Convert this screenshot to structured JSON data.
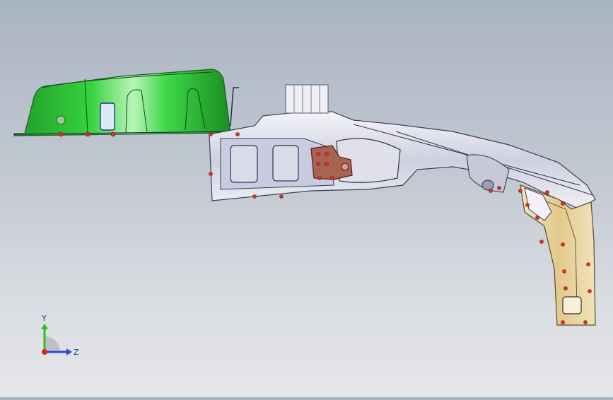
{
  "viewport": {
    "background_top": "#a9b4c3",
    "background_bottom": "#e6e7ea"
  },
  "model": {
    "green_part_color": "#2fc43a",
    "pillar_part_color": "#e9d7a6",
    "rail_part_color": "#dcdde6",
    "bracket_color": "#9a5a48",
    "weld_point_color": "#e0302a"
  },
  "triad": {
    "y_label": "Y",
    "z_label": "Z",
    "y_color": "#22c422",
    "z_color": "#2a4ad6",
    "origin_color": "#e02020"
  }
}
